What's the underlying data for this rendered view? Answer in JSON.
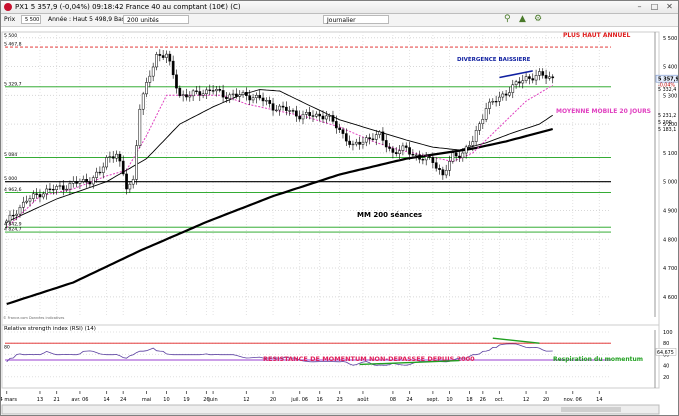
{
  "window": {
    "title": "PX1  5 357,9 (-0,04%) 09:18:42 France 40 au comptant (10€) (C)"
  },
  "toolbar": {
    "label": "Prix",
    "info": "Année : Haut 5 498,9 Bas 4 733,9",
    "units": "200 unités",
    "period": "Journalier",
    "price_field": "5 500"
  },
  "colors": {
    "candle_up": "#ffffff",
    "candle_down": "#000000",
    "ma20": "#e040c0",
    "ma_mid": "#000000",
    "ma200": "#000000",
    "hline_red": "#e02020",
    "hline_green": "#18a018",
    "annotation_red": "#e0205a",
    "annotation_blue": "#1020a0",
    "annotation_green": "#20a020",
    "rsi_line": "#5a3fa0",
    "last_price_bg": "#e8f0ff"
  },
  "source_note": "© France.com Données indicatives",
  "chart_data": [
    {
      "type": "candlestick",
      "title": "",
      "ylim": [
        4530,
        5520
      ],
      "yticks": [
        4600,
        4700,
        4800,
        4900,
        5000,
        5100,
        5200,
        5300,
        5400,
        5500
      ],
      "ytick_labels": [
        "4 600",
        "4 700",
        "4 800",
        "4 900",
        "5 000",
        "5 100",
        "5 200",
        "5 300",
        "5 400",
        "5 500"
      ],
      "xlabels": [
        {
          "i": 0,
          "label": "24 mars"
        },
        {
          "i": 10,
          "label": "13"
        },
        {
          "i": 15,
          "label": "21"
        },
        {
          "i": 22,
          "label": "avr. 06"
        },
        {
          "i": 30,
          "label": "14"
        },
        {
          "i": 35,
          "label": "24"
        },
        {
          "i": 42,
          "label": "mai"
        },
        {
          "i": 48,
          "label": "10"
        },
        {
          "i": 54,
          "label": "19"
        },
        {
          "i": 60,
          "label": "26"
        },
        {
          "i": 62,
          "label": "juin"
        },
        {
          "i": 72,
          "label": "12"
        },
        {
          "i": 80,
          "label": "20"
        },
        {
          "i": 88,
          "label": "juil. 06"
        },
        {
          "i": 94,
          "label": "16"
        },
        {
          "i": 100,
          "label": "23"
        },
        {
          "i": 107,
          "label": "août"
        },
        {
          "i": 116,
          "label": "08"
        },
        {
          "i": 121,
          "label": "24"
        },
        {
          "i": 128,
          "label": "sept."
        },
        {
          "i": 133,
          "label": "10"
        },
        {
          "i": 139,
          "label": "18"
        },
        {
          "i": 143,
          "label": "26"
        },
        {
          "i": 148,
          "label": "oct."
        },
        {
          "i": 156,
          "label": "12"
        },
        {
          "i": 162,
          "label": "20"
        },
        {
          "i": 170,
          "label": "nov. 06"
        },
        {
          "i": 178,
          "label": "14"
        }
      ],
      "n_slots": 182,
      "ohlc": [],
      "waypoints": [
        [
          0,
          4858
        ],
        [
          3,
          4900
        ],
        [
          6,
          4935
        ],
        [
          10,
          4960
        ],
        [
          14,
          4975
        ],
        [
          18,
          4985
        ],
        [
          22,
          5000
        ],
        [
          25,
          5005
        ],
        [
          28,
          5030
        ],
        [
          30,
          5080
        ],
        [
          33,
          5100
        ],
        [
          36,
          4980
        ],
        [
          38,
          5005
        ],
        [
          40,
          5260
        ],
        [
          43,
          5370
        ],
        [
          45,
          5440
        ],
        [
          48,
          5440
        ],
        [
          52,
          5300
        ],
        [
          55,
          5300
        ],
        [
          58,
          5310
        ],
        [
          62,
          5320
        ],
        [
          65,
          5300
        ],
        [
          68,
          5300
        ],
        [
          72,
          5300
        ],
        [
          76,
          5290
        ],
        [
          80,
          5260
        ],
        [
          84,
          5250
        ],
        [
          88,
          5230
        ],
        [
          92,
          5230
        ],
        [
          96,
          5230
        ],
        [
          100,
          5180
        ],
        [
          104,
          5120
        ],
        [
          108,
          5150
        ],
        [
          112,
          5160
        ],
        [
          116,
          5100
        ],
        [
          120,
          5115
        ],
        [
          124,
          5080
        ],
        [
          128,
          5075
        ],
        [
          131,
          5020
        ],
        [
          134,
          5090
        ],
        [
          137,
          5100
        ],
        [
          140,
          5140
        ],
        [
          144,
          5260
        ],
        [
          148,
          5290
        ],
        [
          152,
          5330
        ],
        [
          156,
          5360
        ],
        [
          160,
          5370
        ],
        [
          164,
          5360
        ]
      ],
      "ma20_waypoints": [
        [
          0,
          4840
        ],
        [
          10,
          4950
        ],
        [
          20,
          4975
        ],
        [
          30,
          5020
        ],
        [
          36,
          5040
        ],
        [
          42,
          5160
        ],
        [
          48,
          5300
        ],
        [
          55,
          5300
        ],
        [
          65,
          5300
        ],
        [
          72,
          5270
        ],
        [
          80,
          5250
        ],
        [
          90,
          5225
        ],
        [
          100,
          5190
        ],
        [
          110,
          5140
        ],
        [
          118,
          5110
        ],
        [
          126,
          5090
        ],
        [
          134,
          5070
        ],
        [
          140,
          5100
        ],
        [
          148,
          5190
        ],
        [
          156,
          5280
        ],
        [
          164,
          5335
        ]
      ],
      "ma_mid_waypoints": [
        [
          0,
          4860
        ],
        [
          15,
          4940
        ],
        [
          30,
          5000
        ],
        [
          42,
          5080
        ],
        [
          52,
          5200
        ],
        [
          62,
          5260
        ],
        [
          70,
          5300
        ],
        [
          76,
          5320
        ],
        [
          82,
          5315
        ],
        [
          90,
          5270
        ],
        [
          100,
          5215
        ],
        [
          110,
          5180
        ],
        [
          120,
          5145
        ],
        [
          128,
          5120
        ],
        [
          136,
          5110
        ],
        [
          144,
          5135
        ],
        [
          152,
          5170
        ],
        [
          160,
          5200
        ],
        [
          164,
          5231
        ]
      ],
      "ma200_waypoints": [
        [
          0,
          4575
        ],
        [
          20,
          4650
        ],
        [
          40,
          4760
        ],
        [
          60,
          4860
        ],
        [
          80,
          4950
        ],
        [
          100,
          5025
        ],
        [
          120,
          5080
        ],
        [
          140,
          5115
        ],
        [
          150,
          5140
        ],
        [
          164,
          5183
        ]
      ],
      "hlines": [
        {
          "y": 5467.8,
          "label": "5 467,8",
          "color": "red",
          "dashed": true
        },
        {
          "y": 5329.7,
          "label": "5 329,7",
          "color": "green"
        },
        {
          "y": 5084,
          "label": "5 084",
          "color": "green"
        },
        {
          "y": 5000,
          "label": "5 000",
          "color": "black"
        },
        {
          "y": 4962.6,
          "label": "4 962,6",
          "color": "green"
        },
        {
          "y": 4842,
          "label": "4 842,9",
          "color": "green"
        },
        {
          "y": 4825,
          "label": "4 824,7",
          "color": "green"
        }
      ],
      "right_labels": [
        {
          "y": 5357.9,
          "label": "5 357,9",
          "boxed": true
        },
        {
          "y": 5337,
          "label": "-0,04%"
        },
        {
          "y": 5322,
          "label": "5 332,4"
        },
        {
          "y": 5231.2,
          "label": "5 231,2"
        },
        {
          "y": 5208,
          "label": "5 200"
        },
        {
          "y": 5183.1,
          "label": "5 183,1"
        }
      ],
      "top_value_label": "5 500",
      "annotations": {
        "annual_high": "PLUS HAUT ANNUEL",
        "divergence": "DIVERGENCE BAISSIERE",
        "ma20": "MOYENNE MOBILE 20 JOURS",
        "ma200": "MM 200 séances"
      }
    },
    {
      "type": "line",
      "title": "Relative strength index (RSI) (14)",
      "ylim": [
        0,
        100
      ],
      "yticks": [
        20,
        40,
        60,
        80,
        100
      ],
      "ytick_labels": [
        "20",
        "40",
        "60",
        "80",
        "100"
      ],
      "left_label": "80",
      "last_value_label": "64,675",
      "hlines": [
        {
          "y": 80,
          "color": "red"
        },
        {
          "y": 50,
          "color": "purple"
        }
      ],
      "waypoints": [
        [
          0,
          48
        ],
        [
          4,
          62
        ],
        [
          8,
          58
        ],
        [
          12,
          64
        ],
        [
          16,
          60
        ],
        [
          20,
          58
        ],
        [
          24,
          66
        ],
        [
          28,
          62
        ],
        [
          32,
          60
        ],
        [
          36,
          54
        ],
        [
          40,
          66
        ],
        [
          44,
          70
        ],
        [
          48,
          62
        ],
        [
          52,
          60
        ],
        [
          56,
          60
        ],
        [
          60,
          62
        ],
        [
          64,
          58
        ],
        [
          68,
          58
        ],
        [
          72,
          55
        ],
        [
          76,
          56
        ],
        [
          80,
          52
        ],
        [
          84,
          56
        ],
        [
          88,
          50
        ],
        [
          92,
          48
        ],
        [
          96,
          46
        ],
        [
          100,
          48
        ],
        [
          104,
          42
        ],
        [
          108,
          46
        ],
        [
          112,
          40
        ],
        [
          116,
          44
        ],
        [
          120,
          42
        ],
        [
          124,
          46
        ],
        [
          128,
          46
        ],
        [
          132,
          48
        ],
        [
          136,
          52
        ],
        [
          140,
          58
        ],
        [
          144,
          66
        ],
        [
          148,
          76
        ],
        [
          152,
          78
        ],
        [
          156,
          74
        ],
        [
          160,
          70
        ],
        [
          164,
          64.7
        ]
      ],
      "annotations": {
        "resistance": "RESISTANCE DE MOMENTUM NON-DEPASSEE DEPUIS 2000",
        "respiration": "Respiration du momentum"
      }
    }
  ]
}
